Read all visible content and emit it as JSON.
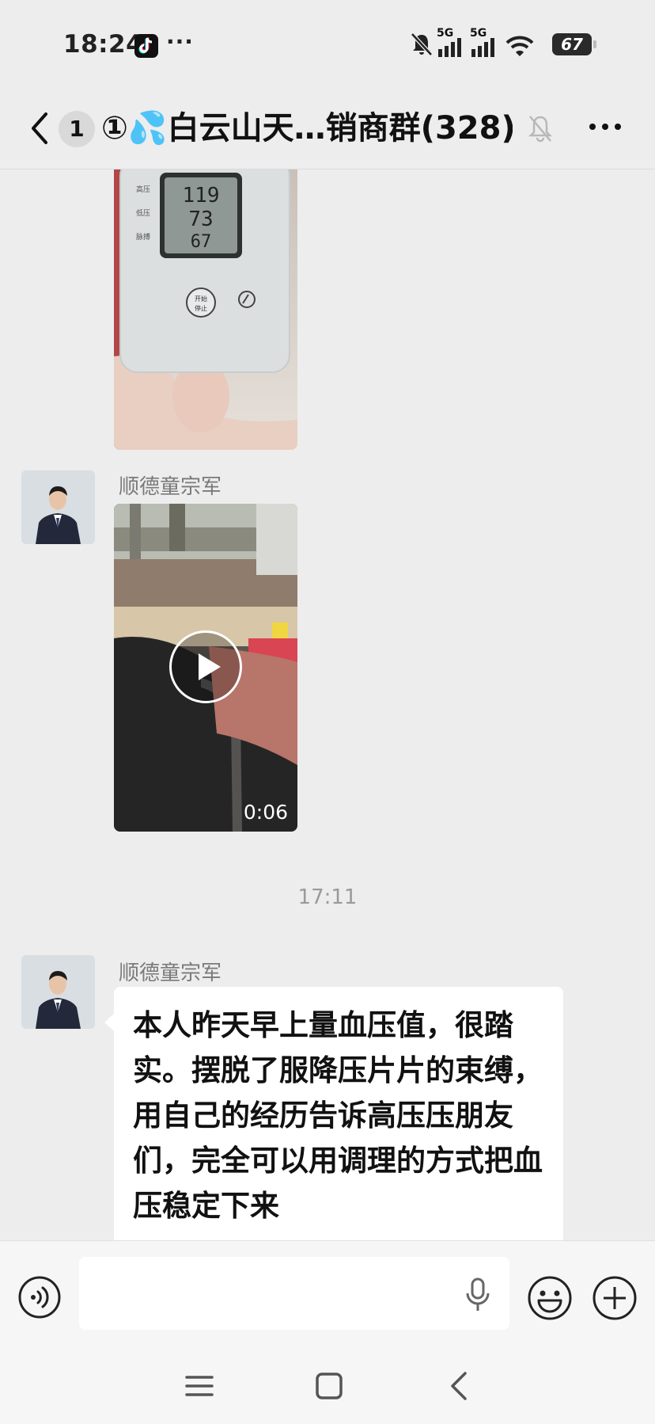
{
  "status_bar": {
    "time": "18:24",
    "more": "···",
    "network_1": "5G",
    "network_2": "5G",
    "battery": "67",
    "icons": [
      "tiktok-icon",
      "mute-bell-icon",
      "signal-icon",
      "wifi-icon",
      "battery-icon"
    ]
  },
  "header": {
    "unread_count": "1",
    "title": "①💦白云山天…销商群(328)",
    "icons": [
      "back-icon",
      "mute-icon",
      "more-icon"
    ]
  },
  "messages": [
    {
      "type": "image",
      "description_icon": "blood-pressure-monitor-photo",
      "monitor_readings": [
        "119",
        "73",
        "67"
      ],
      "monitor_labels": [
        "高压",
        "低压",
        "脉搏"
      ],
      "monitor_button": "开始\n停止"
    },
    {
      "type": "video",
      "sender": "顺德童宗军",
      "duration": "0:06"
    },
    {
      "type": "timestamp",
      "time": "17:11"
    },
    {
      "type": "text",
      "sender": "顺德童宗军",
      "text": "本人昨天早上量血压值，很踏实。摆脱了服降压片片的束缚，用自己的经历告诉高压压朋友们，完全可以用调理的方式把血压稳定下来"
    }
  ],
  "input_bar": {
    "placeholder": "",
    "icons": [
      "voice-icon",
      "mic-icon",
      "emoji-icon",
      "plus-icon"
    ]
  },
  "nav_bar": {
    "icons": [
      "menu-icon",
      "home-icon",
      "back-nav-icon"
    ]
  },
  "colors": {
    "background": "#ededed",
    "bubble": "#ffffff",
    "secondary_text": "#7a7a7a"
  }
}
